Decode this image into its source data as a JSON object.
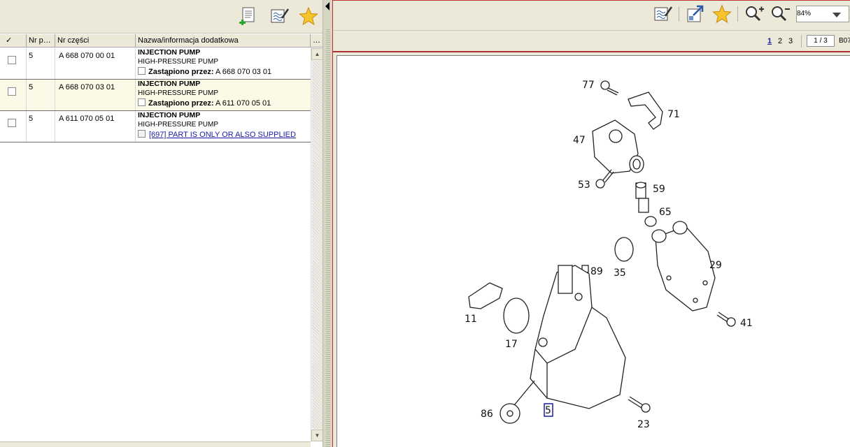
{
  "left_toolbar": {
    "buttons": [
      {
        "name": "add-document",
        "icon": "document-add-icon"
      },
      {
        "name": "notes",
        "icon": "notepad-pen-icon"
      },
      {
        "name": "favorites",
        "icon": "star-icon"
      }
    ]
  },
  "table": {
    "columns": [
      "✓",
      "Nr p…",
      "Nr części",
      "Nazwa/informacja dodatkowa",
      "…"
    ],
    "rows": [
      {
        "qty": "5",
        "part_no": "A 668 070 00 01",
        "name": "INJECTION PUMP",
        "desc": "HIGH-PRESSURE PUMP",
        "sub_label": "Zastąpiono przez:",
        "sub_value": " A 668 070 03 01"
      },
      {
        "qty": "5",
        "part_no": "A 668 070 03 01",
        "name": "INJECTION PUMP",
        "desc": "HIGH-PRESSURE PUMP",
        "sub_label": "Zastąpiono przez:",
        "sub_value": " A 611 070 05 01"
      },
      {
        "qty": "5",
        "part_no": "A 611 070 05 01",
        "name": "INJECTION PUMP",
        "desc": "HIGH-PRESSURE PUMP",
        "link": "[697] PART IS ONLY OR ALSO SUPPLIED"
      }
    ]
  },
  "right_toolbar": {
    "buttons": [
      "notepad-pen-icon",
      "export-icon",
      "star-icon",
      "zoom-in-icon",
      "zoom-out-icon"
    ],
    "zoom": "84%"
  },
  "pager": {
    "pages": [
      "1",
      "2",
      "3"
    ],
    "current": "1",
    "indicator": "1 / 3",
    "code": "B07"
  },
  "diagram": {
    "callouts": [
      "77",
      "71",
      "47",
      "53",
      "59",
      "65",
      "29",
      "35",
      "89",
      "11",
      "17",
      "41",
      "86",
      "5",
      "23"
    ],
    "selected": "5"
  },
  "colors": {
    "accent_red": "#c03030",
    "link_blue": "#1a1aa6",
    "row_alt": "#fbfae6",
    "chrome": "#ece9d8"
  }
}
